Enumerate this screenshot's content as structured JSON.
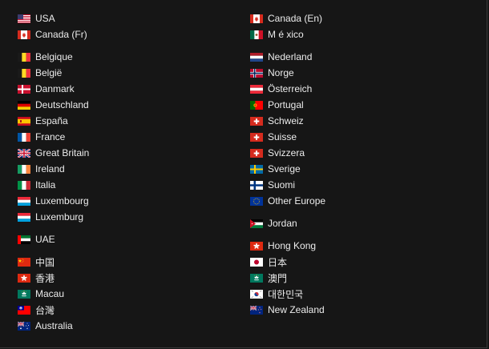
{
  "regions": {
    "left": [
      [
        {
          "name": "usa",
          "label": "USA",
          "flag": "us"
        },
        {
          "name": "canada-fr",
          "label": "Canada (Fr)",
          "flag": "ca"
        }
      ],
      [
        {
          "name": "belgique",
          "label": "Belgique",
          "flag": "be"
        },
        {
          "name": "belgie",
          "label": "België",
          "flag": "be"
        },
        {
          "name": "danmark",
          "label": "Danmark",
          "flag": "dk"
        },
        {
          "name": "deutschland",
          "label": "Deutschland",
          "flag": "de"
        },
        {
          "name": "espana",
          "label": "España",
          "flag": "es"
        },
        {
          "name": "france",
          "label": "France",
          "flag": "fr"
        },
        {
          "name": "great-britain",
          "label": "Great Britain",
          "flag": "gb"
        },
        {
          "name": "ireland",
          "label": "Ireland",
          "flag": "ie"
        },
        {
          "name": "italia",
          "label": "Italia",
          "flag": "it"
        },
        {
          "name": "luxembourg",
          "label": "Luxembourg",
          "flag": "lu"
        },
        {
          "name": "luxemburg",
          "label": "Luxemburg",
          "flag": "lu"
        }
      ],
      [
        {
          "name": "uae",
          "label": "UAE",
          "flag": "ae"
        }
      ],
      [
        {
          "name": "china",
          "label": "中国",
          "flag": "cn"
        },
        {
          "name": "hong-kong-zh",
          "label": "香港",
          "flag": "hk"
        },
        {
          "name": "macau",
          "label": "Macau",
          "flag": "mo"
        },
        {
          "name": "taiwan",
          "label": "台灣",
          "flag": "tw"
        },
        {
          "name": "australia",
          "label": "Australia",
          "flag": "au"
        }
      ]
    ],
    "right": [
      [
        {
          "name": "canada-en",
          "label": "Canada (En)",
          "flag": "ca"
        },
        {
          "name": "mexico",
          "label": "M é xico",
          "flag": "mx"
        }
      ],
      [
        {
          "name": "nederland",
          "label": "Nederland",
          "flag": "nl"
        },
        {
          "name": "norge",
          "label": "Norge",
          "flag": "no"
        },
        {
          "name": "osterreich",
          "label": "Österreich",
          "flag": "at"
        },
        {
          "name": "portugal",
          "label": "Portugal",
          "flag": "pt"
        },
        {
          "name": "schweiz",
          "label": "Schweiz",
          "flag": "ch"
        },
        {
          "name": "suisse",
          "label": "Suisse",
          "flag": "ch"
        },
        {
          "name": "svizzera",
          "label": "Svizzera",
          "flag": "ch"
        },
        {
          "name": "sverige",
          "label": "Sverige",
          "flag": "se"
        },
        {
          "name": "suomi",
          "label": "Suomi",
          "flag": "fi"
        },
        {
          "name": "other-europe",
          "label": "Other Europe",
          "flag": "eu"
        }
      ],
      [
        {
          "name": "jordan",
          "label": "Jordan",
          "flag": "jo"
        }
      ],
      [
        {
          "name": "hong-kong",
          "label": "Hong Kong",
          "flag": "hk"
        },
        {
          "name": "japan",
          "label": "日本",
          "flag": "jp"
        },
        {
          "name": "macau-zh",
          "label": "澳門",
          "flag": "mo"
        },
        {
          "name": "korea",
          "label": "대한민국",
          "flag": "kr"
        },
        {
          "name": "new-zealand",
          "label": "New Zealand",
          "flag": "nz"
        }
      ]
    ]
  },
  "colors": {
    "background": "#161616",
    "text": "#ececec"
  }
}
